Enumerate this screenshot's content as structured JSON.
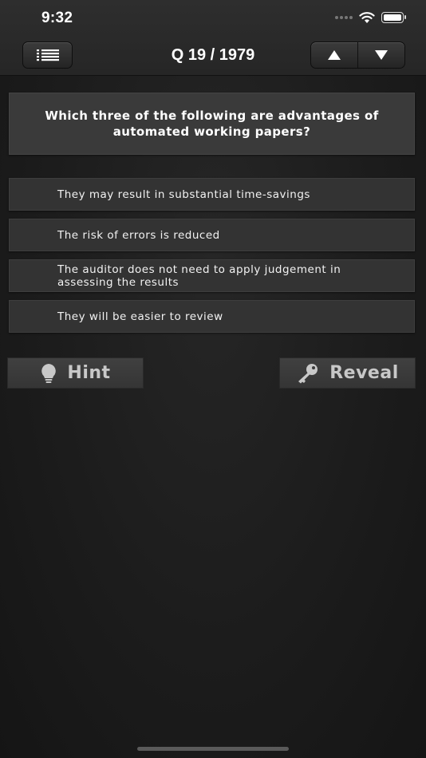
{
  "status": {
    "time": "9:32"
  },
  "header": {
    "counter": "Q 19 / 1979"
  },
  "question": {
    "text": "Which three of the following are advantages of automated working papers?"
  },
  "options": [
    {
      "text": "They may result in substantial time-savings"
    },
    {
      "text": "The risk of errors is reduced"
    },
    {
      "text": "The auditor does not need to apply judgement in assessing the results"
    },
    {
      "text": "They will be easier to review"
    }
  ],
  "actions": {
    "hint": "Hint",
    "reveal": "Reveal"
  },
  "icons": {
    "menu": "list-icon",
    "up": "arrow-up-icon",
    "down": "arrow-down-icon",
    "hint": "lightbulb-icon",
    "reveal": "key-icon"
  }
}
